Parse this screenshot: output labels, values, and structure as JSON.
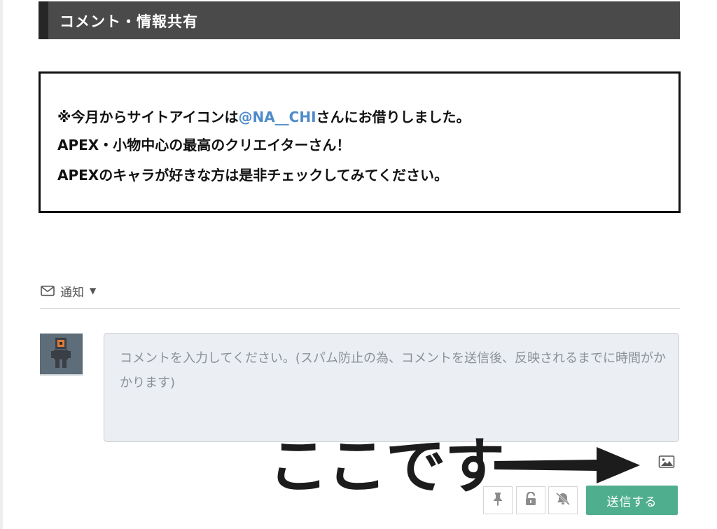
{
  "section": {
    "title": "コメント・情報共有"
  },
  "notice": {
    "line1_prefix": "※今月からサイトアイコンは",
    "line1_mention": "@NA__CHI",
    "line1_suffix": "さんにお借りしました。",
    "line2": "APEX・小物中心の最高のクリエイターさん！",
    "line3": "APEXのキャラが好きな方は是非チェックしてみてください。"
  },
  "notify": {
    "label": "通知",
    "icon": "mail-icon"
  },
  "comment": {
    "placeholder": "コメントを入力してください。(スパム防止の為、コメントを送信後、反映されるまでに時間がかかります)"
  },
  "annotation": {
    "text": "ここです"
  },
  "toolbar": {
    "icons": [
      "image-icon",
      "pin-icon",
      "lock-icon",
      "bell-off-icon"
    ],
    "submit_label": "送信する"
  },
  "colors": {
    "header_bg": "#4a4a4a",
    "mention": "#4f8bc9",
    "submit": "#4fae8d",
    "comment_bg": "#ebeef2"
  }
}
